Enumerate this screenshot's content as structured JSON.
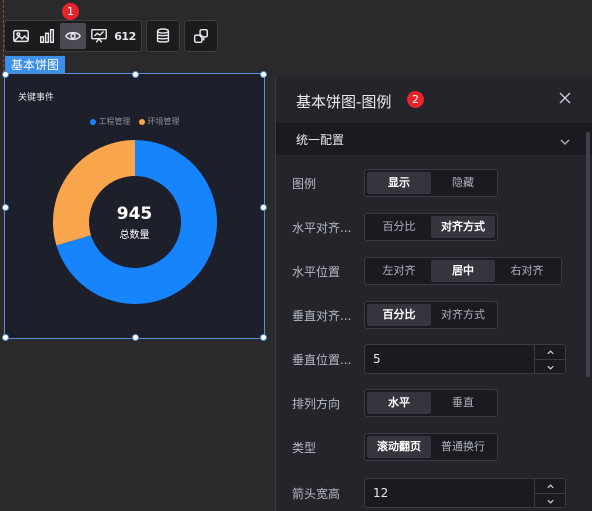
{
  "toolbar": {
    "icons": [
      "image-icon",
      "bar-chart-icon",
      "eye-icon",
      "screen-chart-icon",
      "number-612-icon",
      "database-icon",
      "link-swap-icon"
    ],
    "number_label": "612",
    "badge1": "1"
  },
  "widget": {
    "tag_label": "基本饼图",
    "chart_title": "关键事件",
    "total_value": "945",
    "total_label": "总数量"
  },
  "chart_data": {
    "type": "pie",
    "title": "关键事件",
    "categories": [
      "工程管理",
      "环境管理"
    ],
    "values": [
      665,
      280
    ],
    "colors": [
      "#1684fc",
      "#f9a54c"
    ],
    "legend_position": "top-center",
    "center_value": 945,
    "center_label": "总数量"
  },
  "panel": {
    "title": "基本饼图-图例",
    "badge2": "2",
    "section_title": "统一配置",
    "rows": {
      "legend": {
        "label": "图例",
        "options": [
          "显示",
          "隐藏"
        ]
      },
      "h_align_mode": {
        "label": "水平对齐...",
        "options": [
          "百分比",
          "对齐方式"
        ]
      },
      "h_position": {
        "label": "水平位置",
        "options": [
          "左对齐",
          "居中",
          "右对齐"
        ]
      },
      "v_align_mode": {
        "label": "垂直对齐...",
        "options": [
          "百分比",
          "对齐方式"
        ]
      },
      "v_position": {
        "label": "垂直位置...",
        "value": "5"
      },
      "orientation": {
        "label": "排列方向",
        "options": [
          "水平",
          "垂直"
        ]
      },
      "type": {
        "label": "类型",
        "options": [
          "滚动翻页",
          "普通换行"
        ]
      },
      "arrow_width": {
        "label": "箭头宽高",
        "value": "12"
      }
    }
  }
}
